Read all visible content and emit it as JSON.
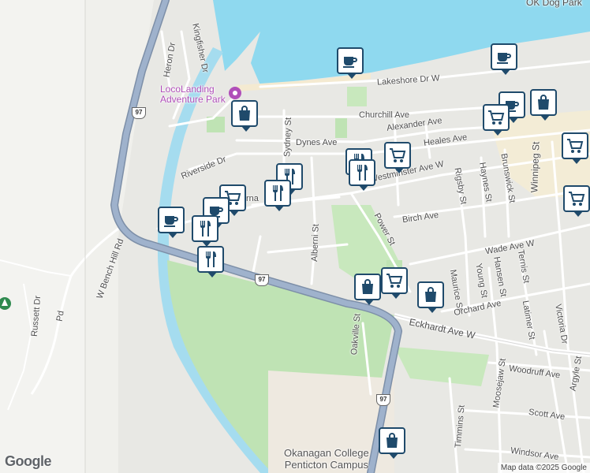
{
  "map": {
    "labels": {
      "dog_park": "OK Dog Park",
      "lakeshore": "Lakeshore Dr W",
      "churchill": "Churchill Ave",
      "alexander": "Alexander Ave",
      "heales": "Heales Ave",
      "dynes": "Dynes Ave",
      "sydney": "Sydney St",
      "riverside": "Riverside Dr",
      "westminster": "Westminster Ave W",
      "birch": "Birch Ave",
      "power": "Power St",
      "alberni": "Alberni St",
      "rigsby": "Rigsby St",
      "haynes": "Haynes St",
      "brunswick": "Brunswick St",
      "winnipeg": "Winnipeg St",
      "wade": "Wade Ave W",
      "maurice": "Maurice St",
      "young": "Young St",
      "hansen": "Hansen St",
      "ternis": "Ternis St",
      "orchard": "Orchard Ave",
      "latimer": "Latimer St",
      "victoria": "Victoria Dr",
      "eckhardt": "Eckhardt Ave W",
      "oakville": "Oakville St",
      "moosejaw": "Moosejaw St",
      "woodruff": "Woodruff Ave",
      "argyle": "Argyle St",
      "scott": "Scott Ave",
      "timmins": "Timmins St",
      "windsor": "Windsor Ave",
      "heron": "Heron Dr",
      "kingfisher": "Kingfisher Dr",
      "w_bench_hill": "W Bench Hill Rd",
      "russett": "Russett Dr",
      "penticton_partial": "Pe",
      "locolanding_line1": "LocoLanding",
      "locolanding_line2": "Adventure Park",
      "okanagan_line1": "Okanagan College",
      "okanagan_line2": "Penticton Campus",
      "road_partial": "rna"
    },
    "highway_shields": [
      "97",
      "97",
      "97"
    ],
    "logo": "Google",
    "attribution": "Map data ©2025 Google",
    "colors": {
      "water": "#8fd9ef",
      "park": "#bfe3b4",
      "highway": "#8fa4c0",
      "river": "#a5dcef",
      "marker_border": "#1f4a6b"
    },
    "markers": [
      {
        "type": "cafe-icon"
      },
      {
        "type": "cafe-icon"
      },
      {
        "type": "shopping-bag-icon"
      },
      {
        "type": "shopping-bag-icon"
      },
      {
        "type": "cafe-icon"
      },
      {
        "type": "shopping-cart-icon"
      },
      {
        "type": "shopping-cart-icon"
      },
      {
        "type": "restaurant-icon"
      },
      {
        "type": "restaurant-icon"
      },
      {
        "type": "restaurant-icon"
      },
      {
        "type": "shopping-cart-icon"
      },
      {
        "type": "cafe-icon"
      },
      {
        "type": "cafe-icon"
      },
      {
        "type": "restaurant-icon"
      },
      {
        "type": "restaurant-icon"
      },
      {
        "type": "shopping-bag-icon"
      },
      {
        "type": "shopping-cart-icon"
      },
      {
        "type": "shopping-bag-icon"
      },
      {
        "type": "shopping-bag-icon"
      },
      {
        "type": "shopping-cart-icon"
      },
      {
        "type": "shopping-cart-icon"
      }
    ]
  }
}
